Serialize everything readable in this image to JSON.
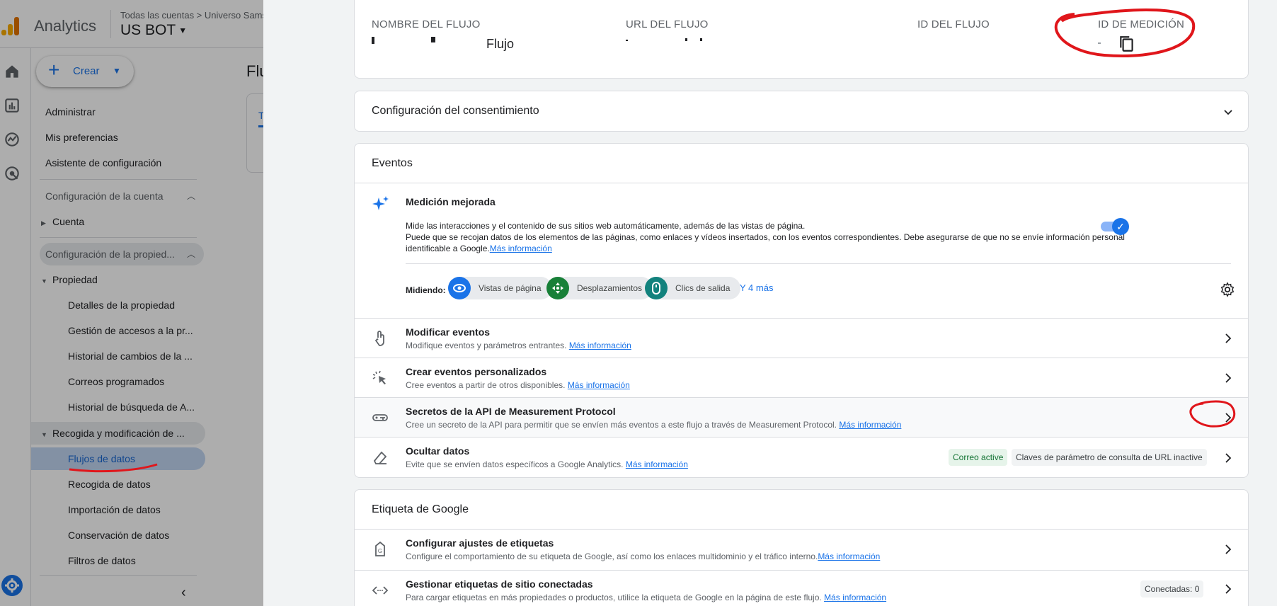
{
  "header": {
    "app_name": "Analytics",
    "breadcrumb": "Todas las cuentas > Universo Samsung",
    "account": "US BOT"
  },
  "sidebar": {
    "create_label": "Crear",
    "admin": "Administrar",
    "prefs": "Mis preferencias",
    "setup": "Asistente de configuración",
    "account_section": "Configuración de la cuenta",
    "account": "Cuenta",
    "property_section": "Configuración de la propied...",
    "property": "Propiedad",
    "prop_items": [
      "Detalles de la propiedad",
      "Gestión de accesos a la pr...",
      "Historial de cambios de la ...",
      "Correos programados",
      "Historial de búsqueda de A..."
    ],
    "collection_group": "Recogida y modificación de ...",
    "collection_items": [
      "Flujos de datos",
      "Recogida de datos",
      "Importación de datos",
      "Conservación de datos",
      "Filtros de datos"
    ]
  },
  "background": {
    "title": "Flu",
    "tab_letter": "T"
  },
  "stream_details": {
    "name_label": "NOMBRE DEL FLUJO",
    "name_value": "Flujo",
    "url_label": "URL DEL FLUJO",
    "id_label": "ID DEL FLUJO",
    "measurement_label": "ID DE MEDICIÓN"
  },
  "consent": {
    "title": "Configuración del consentimiento"
  },
  "events": {
    "title": "Eventos",
    "enhanced": {
      "title": "Medición mejorada",
      "desc1": "Mide las interacciones y el contenido de sus sitios web automáticamente, además de las vistas de página.",
      "desc2": "Puede que se recojan datos de los elementos de las páginas, como enlaces y vídeos insertados, con los eventos correspondientes. Debe asegurarse de que no se envíe información personal",
      "desc3": "identificable a Google.",
      "more": "Más información",
      "measuring": "Midiendo:",
      "chips": [
        "Vistas de página",
        "Desplazamientos",
        "Clics de salida"
      ],
      "chip_colors": [
        "#1a73e8",
        "#188038",
        "#12827d"
      ],
      "and_more": "Y 4 más",
      "enabled": true
    },
    "rows": [
      {
        "title": "Modificar eventos",
        "desc": "Modifique eventos y parámetros entrantes.",
        "more": "Más información"
      },
      {
        "title": "Crear eventos personalizados",
        "desc": "Cree eventos a partir de otros disponibles.",
        "more": "Más información"
      },
      {
        "title": "Secretos de la API de Measurement Protocol",
        "desc": "Cree un secreto de la API para permitir que se envíen más eventos a este flujo a través de Measurement Protocol.",
        "more": "Más información"
      },
      {
        "title": "Ocultar datos",
        "desc": "Evite que se envíen datos específicos a Google Analytics.",
        "more": "Más información",
        "tag_active": "Correo active",
        "tag_inactive": "Claves de parámetro de consulta de URL inactive"
      }
    ]
  },
  "google_tag": {
    "title": "Etiqueta de Google",
    "rows": [
      {
        "title": "Configurar ajustes de etiquetas",
        "desc": "Configure el comportamiento de su etiqueta de Google, así como los enlaces multidominio y el tráfico interno.",
        "more": "Más información"
      },
      {
        "title": "Gestionar etiquetas de sitio conectadas",
        "desc": "Para cargar etiquetas en más propiedades o productos, utilice la etiqueta de Google en la página de este flujo.",
        "more": "Más información",
        "badge": "Conectadas: 0"
      }
    ]
  },
  "colors": {
    "accent": "#1a73e8",
    "annotation": "#e0161b",
    "active_tag_bg": "#e6f4ea",
    "active_tag_fg": "#137333"
  }
}
